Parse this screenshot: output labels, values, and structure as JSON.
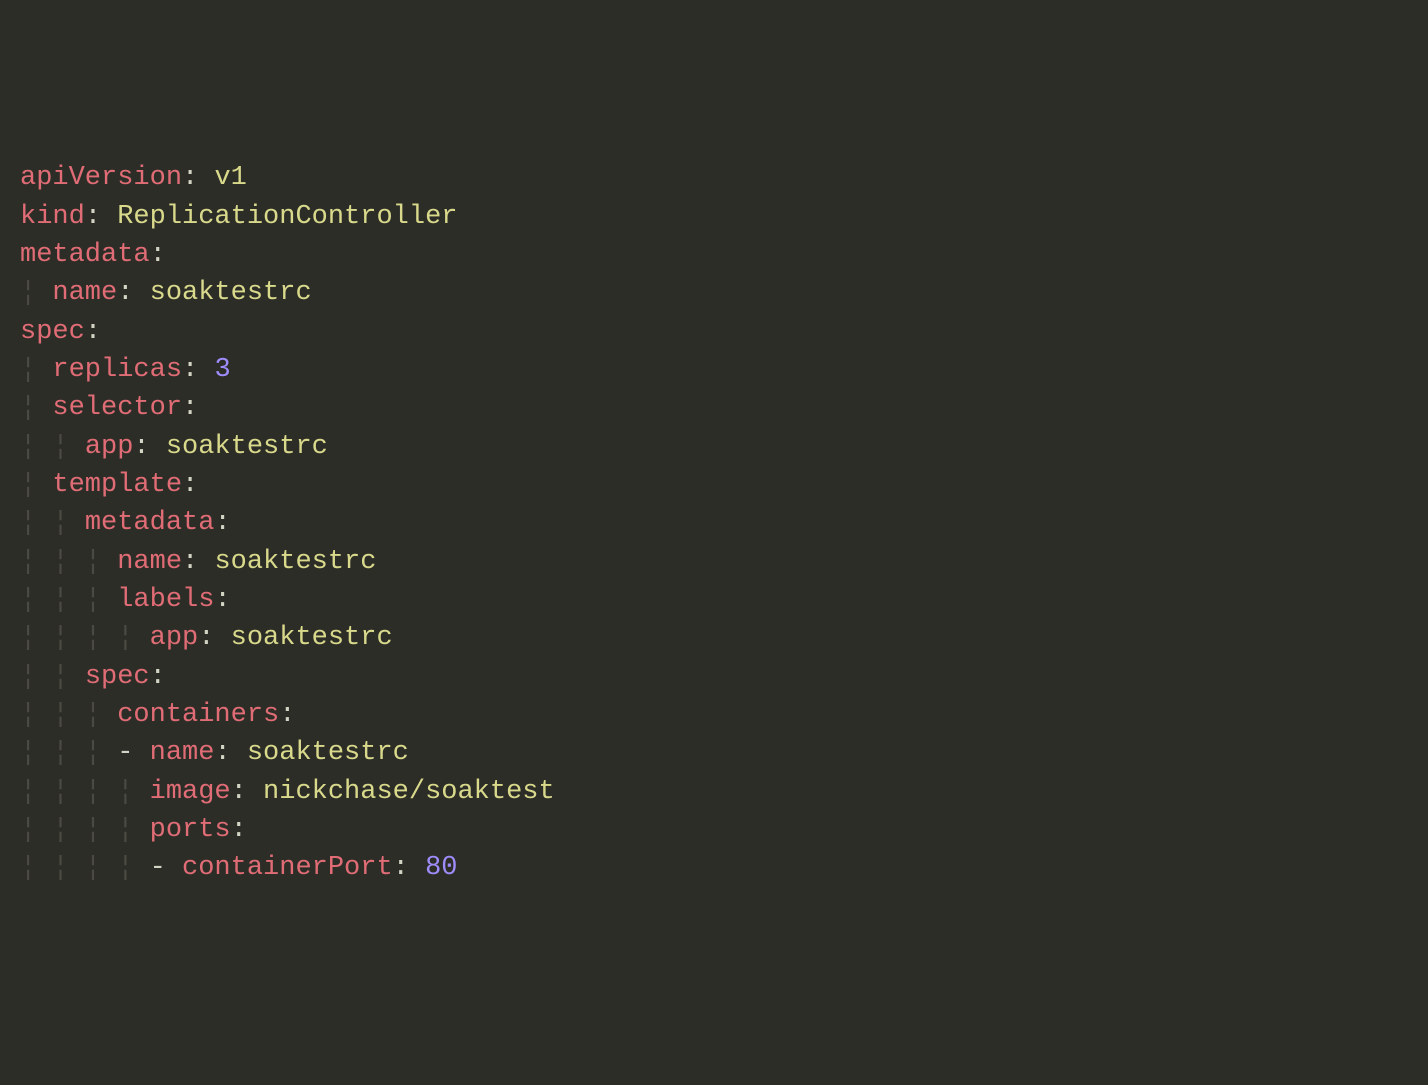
{
  "yaml": {
    "apiVersion_key": "apiVersion",
    "apiVersion_val": "v1",
    "kind_key": "kind",
    "kind_val": "ReplicationController",
    "metadata_key": "metadata",
    "metadata_name_key": "name",
    "metadata_name_val": "soaktestrc",
    "spec_key": "spec",
    "replicas_key": "replicas",
    "replicas_val": "3",
    "selector_key": "selector",
    "selector_app_key": "app",
    "selector_app_val": "soaktestrc",
    "template_key": "template",
    "t_metadata_key": "metadata",
    "t_name_key": "name",
    "t_name_val": "soaktestrc",
    "t_labels_key": "labels",
    "t_labels_app_key": "app",
    "t_labels_app_val": "soaktestrc",
    "t_spec_key": "spec",
    "containers_key": "containers",
    "c_name_key": "name",
    "c_name_val": "soaktestrc",
    "c_image_key": "image",
    "c_image_val": "nickchase/soaktest",
    "c_ports_key": "ports",
    "c_port_key": "containerPort",
    "c_port_val": "80"
  }
}
